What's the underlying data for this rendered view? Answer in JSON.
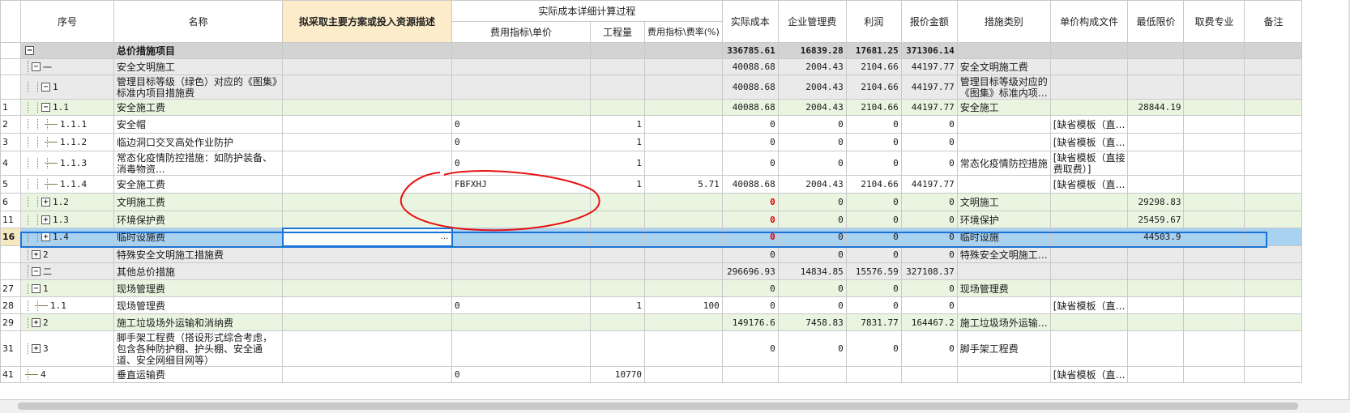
{
  "header": {
    "seq": "序号",
    "name": "名称",
    "plan": "拟采取主要方案或投入资源描述",
    "detail_group": "实际成本详细计算过程",
    "fee_index": "费用指标\\单价",
    "quantity": "工程量",
    "fee_rate": "费用指标\\费率(%)",
    "actual_cost": "实际成本",
    "mgmt_fee": "企业管理费",
    "profit": "利润",
    "quote": "报价金额",
    "measure_type": "措施类别",
    "unit_price_file": "单价构成文件",
    "min_price": "最低限价",
    "fee_specialty": "取费专业",
    "remark": "备注"
  },
  "rows": [
    {
      "rowno": "",
      "toggle": "−",
      "seq": "",
      "name": "总价措施项目",
      "plan": "",
      "fee_index": "",
      "qty": "",
      "rate": "",
      "cost": "336785.61",
      "mgmt": "16839.28",
      "profit": "17681.25",
      "quote": "371306.14",
      "mtype": "",
      "upfile": "",
      "minp": "",
      "spec": "",
      "remark": ""
    },
    {
      "rowno": "",
      "toggle": "−",
      "seq": "一",
      "name": "安全文明施工",
      "plan": "",
      "fee_index": "",
      "qty": "",
      "rate": "",
      "cost": "40088.68",
      "mgmt": "2004.43",
      "profit": "2104.66",
      "quote": "44197.77",
      "mtype": "安全文明施工费",
      "upfile": "",
      "minp": "",
      "spec": "",
      "remark": ""
    },
    {
      "rowno": "",
      "toggle": "−",
      "seq": "1",
      "name": "管理目标等级（绿色）对应的《图集》标准内项目措施费",
      "plan": "",
      "fee_index": "",
      "qty": "",
      "rate": "",
      "cost": "40088.68",
      "mgmt": "2004.43",
      "profit": "2104.66",
      "quote": "44197.77",
      "mtype": "管理目标等级对应的《图集》标准内项…",
      "upfile": "",
      "minp": "",
      "spec": "",
      "remark": ""
    },
    {
      "rowno": "1",
      "toggle": "−",
      "seq": "1.1",
      "name": "安全施工费",
      "plan": "",
      "fee_index": "",
      "qty": "",
      "rate": "",
      "cost": "40088.68",
      "mgmt": "2004.43",
      "profit": "2104.66",
      "quote": "44197.77",
      "mtype": "安全施工",
      "upfile": "",
      "minp": "28844.19",
      "spec": "",
      "remark": ""
    },
    {
      "rowno": "2",
      "toggle": "",
      "seq": "1.1.1",
      "name": "安全帽",
      "plan": "",
      "fee_index": "0",
      "qty": "1",
      "rate": "",
      "cost": "0",
      "mgmt": "0",
      "profit": "0",
      "quote": "0",
      "mtype": "",
      "upfile": "[缺省模板（直…",
      "minp": "",
      "spec": "",
      "remark": ""
    },
    {
      "rowno": "3",
      "toggle": "",
      "seq": "1.1.2",
      "name": "临边洞口交叉高处作业防护",
      "plan": "",
      "fee_index": "0",
      "qty": "1",
      "rate": "",
      "cost": "0",
      "mgmt": "0",
      "profit": "0",
      "quote": "0",
      "mtype": "",
      "upfile": "[缺省模板（直…",
      "minp": "",
      "spec": "",
      "remark": ""
    },
    {
      "rowno": "4",
      "toggle": "",
      "seq": "1.1.3",
      "name": "常态化疫情防控措施：如防护装备、消毒物资...",
      "plan": "",
      "fee_index": "0",
      "qty": "1",
      "rate": "",
      "cost": "0",
      "mgmt": "0",
      "profit": "0",
      "quote": "0",
      "mtype": "常态化疫情防控措施",
      "upfile": "[缺省模板（直接费取费）]",
      "minp": "",
      "spec": "",
      "remark": ""
    },
    {
      "rowno": "5",
      "toggle": "",
      "seq": "1.1.4",
      "name": "安全施工费",
      "plan": "",
      "fee_index": "FBFXHJ",
      "qty": "1",
      "rate": "5.71",
      "cost": "40088.68",
      "mgmt": "2004.43",
      "profit": "2104.66",
      "quote": "44197.77",
      "mtype": "",
      "upfile": "[缺省模板（直…",
      "minp": "",
      "spec": "",
      "remark": ""
    },
    {
      "rowno": "6",
      "toggle": "+",
      "seq": "1.2",
      "name": "文明施工费",
      "plan": "",
      "fee_index": "",
      "qty": "",
      "rate": "",
      "cost": "0",
      "mgmt": "0",
      "profit": "0",
      "quote": "0",
      "mtype": "文明施工",
      "upfile": "",
      "minp": "29298.83",
      "spec": "",
      "remark": ""
    },
    {
      "rowno": "11",
      "toggle": "+",
      "seq": "1.3",
      "name": "环境保护费",
      "plan": "",
      "fee_index": "",
      "qty": "",
      "rate": "",
      "cost": "0",
      "mgmt": "0",
      "profit": "0",
      "quote": "0",
      "mtype": "环境保护",
      "upfile": "",
      "minp": "25459.67",
      "spec": "",
      "remark": ""
    },
    {
      "rowno": "16",
      "toggle": "+",
      "seq": "1.4",
      "name": "临时设施费",
      "plan": "…",
      "fee_index": "",
      "qty": "",
      "rate": "",
      "cost": "0",
      "mgmt": "0",
      "profit": "0",
      "quote": "0",
      "mtype": "临时设施",
      "upfile": "",
      "minp": "44503.9",
      "spec": "",
      "remark": ""
    },
    {
      "rowno": "",
      "toggle": "+",
      "seq": "2",
      "name": "特殊安全文明施工措施费",
      "plan": "",
      "fee_index": "",
      "qty": "",
      "rate": "",
      "cost": "0",
      "mgmt": "0",
      "profit": "0",
      "quote": "0",
      "mtype": "特殊安全文明施工…",
      "upfile": "",
      "minp": "",
      "spec": "",
      "remark": ""
    },
    {
      "rowno": "",
      "toggle": "−",
      "seq": "二",
      "name": "其他总价措施",
      "plan": "",
      "fee_index": "",
      "qty": "",
      "rate": "",
      "cost": "296696.93",
      "mgmt": "14834.85",
      "profit": "15576.59",
      "quote": "327108.37",
      "mtype": "",
      "upfile": "",
      "minp": "",
      "spec": "",
      "remark": ""
    },
    {
      "rowno": "27",
      "toggle": "−",
      "seq": "1",
      "name": "现场管理费",
      "plan": "",
      "fee_index": "",
      "qty": "",
      "rate": "",
      "cost": "0",
      "mgmt": "0",
      "profit": "0",
      "quote": "0",
      "mtype": "现场管理费",
      "upfile": "",
      "minp": "",
      "spec": "",
      "remark": ""
    },
    {
      "rowno": "28",
      "toggle": "",
      "seq": "1.1",
      "name": "现场管理费",
      "plan": "",
      "fee_index": "0",
      "qty": "1",
      "rate": "100",
      "cost": "0",
      "mgmt": "0",
      "profit": "0",
      "quote": "0",
      "mtype": "",
      "upfile": "[缺省模板（直…",
      "minp": "",
      "spec": "",
      "remark": ""
    },
    {
      "rowno": "29",
      "toggle": "+",
      "seq": "2",
      "name": "施工垃圾场外运输和消纳费",
      "plan": "",
      "fee_index": "",
      "qty": "",
      "rate": "",
      "cost": "149176.6",
      "mgmt": "7458.83",
      "profit": "7831.77",
      "quote": "164467.2",
      "mtype": "施工垃圾场外运输…",
      "upfile": "",
      "minp": "",
      "spec": "",
      "remark": ""
    },
    {
      "rowno": "31",
      "toggle": "+",
      "seq": "3",
      "name": "脚手架工程费（搭设形式综合考虑，包含各种防护棚、护头棚、安全通道、安全网细目网等）",
      "plan": "",
      "fee_index": "",
      "qty": "",
      "rate": "",
      "cost": "0",
      "mgmt": "0",
      "profit": "0",
      "quote": "0",
      "mtype": "脚手架工程费",
      "upfile": "",
      "minp": "",
      "spec": "",
      "remark": ""
    },
    {
      "rowno": "41",
      "toggle": "",
      "seq": "4",
      "name": "垂直运输费",
      "plan": "",
      "fee_index": "0",
      "qty": "10770",
      "rate": "",
      "cost": "",
      "mgmt": "",
      "profit": "",
      "quote": "",
      "mtype": "",
      "upfile": "[缺省模板（直…",
      "minp": "",
      "spec": "",
      "remark": ""
    }
  ]
}
